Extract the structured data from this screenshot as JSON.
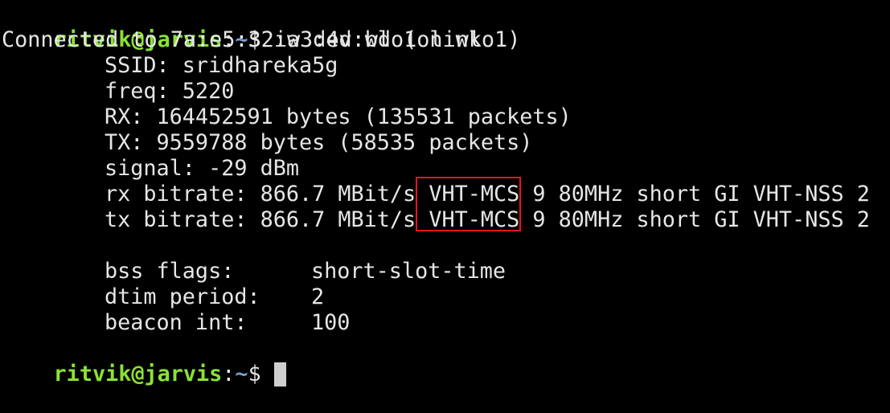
{
  "prompt": {
    "user_host": "ritvik@jarvis",
    "colon": ":",
    "path": "~",
    "dollar": "$"
  },
  "command": " iw dev wlo1 link",
  "output": {
    "connected": "Connected to 7a:e5:32:a3:4d:bd (on wlo1)",
    "ssid": "SSID: sridhareka5g",
    "freq": "freq: 5220",
    "rx": "RX: 164452591 bytes (135531 packets)",
    "tx": "TX: 9559788 bytes (58535 packets)",
    "signal": "signal: -29 dBm",
    "rx_bitrate": {
      "pre": "rx bitrate: 866.7 MBit/s ",
      "highlight": "VHT-MCS",
      "post": " 9 80MHz short GI VHT-NSS 2"
    },
    "tx_bitrate": {
      "pre": "tx bitrate: 866.7 MBit/s ",
      "highlight": "VHT-MCS",
      "post": " 9 80MHz short GI VHT-NSS 2"
    },
    "bss_flags": {
      "key": "bss flags:",
      "value": "short-slot-time"
    },
    "dtim_period": {
      "key": "dtim period:",
      "value": "2"
    },
    "beacon_int": {
      "key": "beacon int:",
      "value": "100"
    }
  },
  "colors": {
    "background": "#000000",
    "text": "#e6e6e6",
    "user_host": "#8ae234",
    "path": "#729fcf",
    "highlight_box": "#e3161b",
    "cursor": "#cfcfcf"
  }
}
